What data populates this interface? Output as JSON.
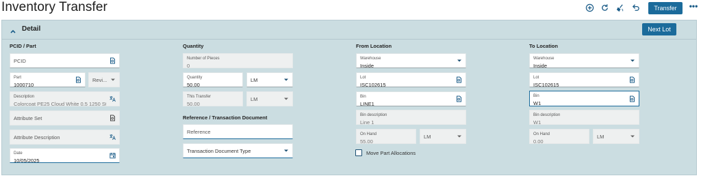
{
  "page": {
    "title": "Inventory Transfer"
  },
  "toolbar": {
    "transfer_label": "Transfer",
    "more_label": "•••"
  },
  "detail": {
    "heading": "Detail",
    "next_lot_label": "Next Lot"
  },
  "pcid_part": {
    "heading": "PCID / Part",
    "pcid_placeholder": "PCID",
    "part_label": "Part",
    "part_value": "1000710",
    "revision_placeholder": "Revi...",
    "description_label": "Description",
    "description_value": "Colorcoat PE25 Cloud White 0.5 1250 Stee",
    "attribute_set_placeholder": "Attribute Set",
    "attribute_description_placeholder": "Attribute Description",
    "date_label": "Date",
    "date_value": "10/05/2025"
  },
  "quantity": {
    "heading": "Quantity",
    "pieces_label": "Number of Pieces",
    "pieces_value": "0",
    "qty_label": "Quantity",
    "qty_value": "50.00",
    "qty_uom": "LM",
    "this_transfer_label": "This Transfer",
    "this_transfer_value": "50.00",
    "this_transfer_uom": "LM"
  },
  "reference": {
    "heading": "Reference / Transaction Document",
    "reference_placeholder": "Reference",
    "doc_type_placeholder": "Transaction Document Type"
  },
  "from": {
    "heading": "From Location",
    "warehouse_label": "Warehouse",
    "warehouse_value": "Inside",
    "lot_label": "Lot",
    "lot_value": "ISC102615",
    "bin_label": "Bin",
    "bin_value": "LINE1",
    "bin_desc_label": "Bin description",
    "bin_desc_value": "Line 1",
    "on_hand_label": "On Hand",
    "on_hand_value": "55.00",
    "on_hand_uom": "LM",
    "move_alloc_label": "Move Part Allocations",
    "move_alloc_checked": false
  },
  "to": {
    "heading": "To Location",
    "warehouse_label": "Warehouse",
    "warehouse_value": "Inside",
    "lot_label": "Lot",
    "lot_value": "ISC102615",
    "bin_label": "Bin",
    "bin_value": "W1",
    "bin_desc_label": "Bin description",
    "bin_desc_value": "W1",
    "on_hand_label": "On Hand",
    "on_hand_value": "0.00",
    "on_hand_uom": "LM"
  },
  "colors": {
    "accent": "#1b6b9b",
    "panel": "#cbdde1"
  }
}
